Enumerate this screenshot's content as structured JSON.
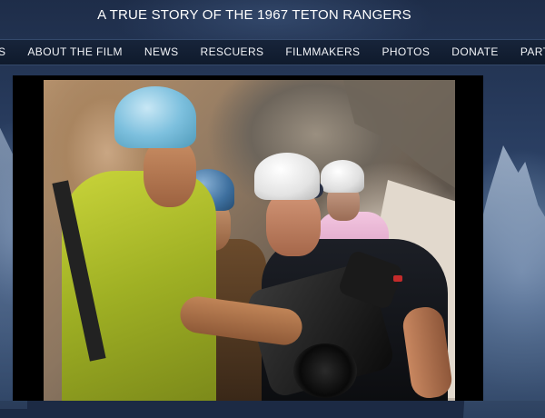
{
  "site": {
    "title": "A TRUE STORY OF THE 1967 TETON RANGERS"
  },
  "nav": {
    "items": [
      {
        "label": "S"
      },
      {
        "label": "ABOUT THE FILM"
      },
      {
        "label": "NEWS"
      },
      {
        "label": "RESCUERS"
      },
      {
        "label": "FILMMAKERS"
      },
      {
        "label": "PHOTOS"
      },
      {
        "label": "DONATE"
      },
      {
        "label": "PARTNE"
      }
    ]
  },
  "colors": {
    "nav_bg": "#0f1a2c",
    "background": "#2b4064",
    "text": "#ffffff"
  }
}
